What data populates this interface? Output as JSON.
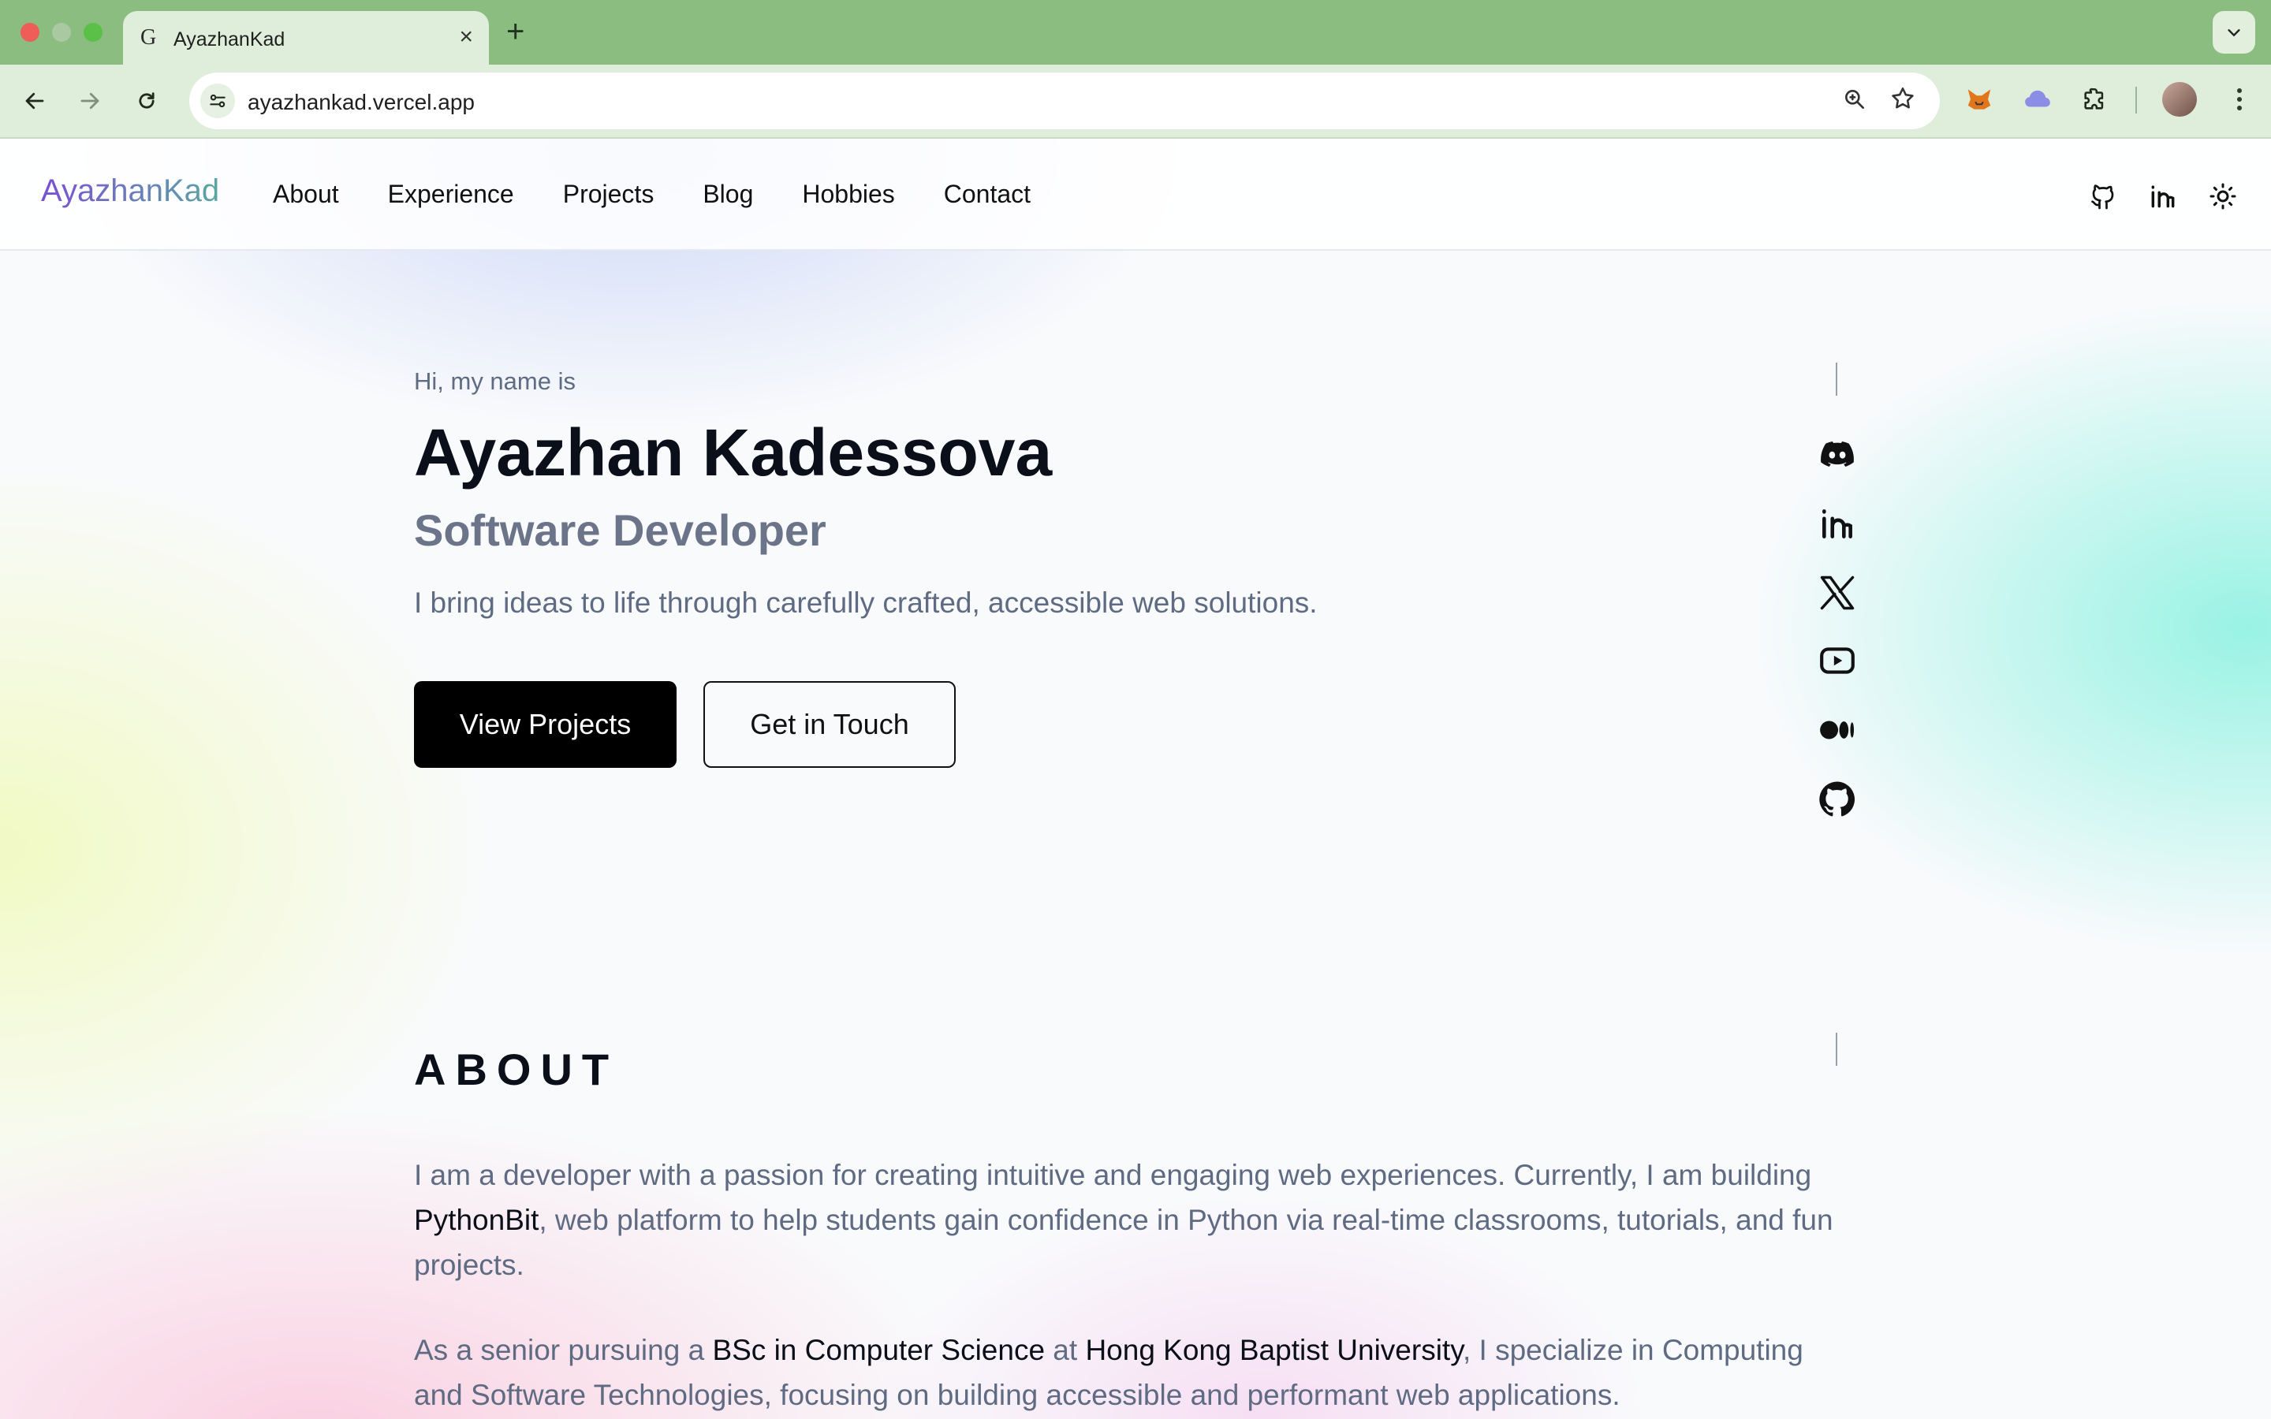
{
  "browser": {
    "tab_title": "AyazhanKad",
    "tab_favicon": "G",
    "url": "ayazhankad.vercel.app"
  },
  "site": {
    "brand": "AyazhanKad",
    "nav": [
      "About",
      "Experience",
      "Projects",
      "Blog",
      "Hobbies",
      "Contact"
    ],
    "nav_icons": [
      "github-icon",
      "linkedin-icon",
      "sun-icon"
    ]
  },
  "hero": {
    "greeting": "Hi, my name is",
    "name": "Ayazhan Kadessova",
    "role": "Software Developer",
    "tagline": "I bring ideas to life through carefully crafted, accessible web solutions.",
    "primary_button": "View Projects",
    "secondary_button": "Get in Touch"
  },
  "social_rail": [
    "discord-icon",
    "linkedin-icon",
    "x-icon",
    "youtube-icon",
    "medium-icon",
    "github-icon"
  ],
  "about": {
    "heading": "ABOUT",
    "p1_a": "I am a developer with a passion for creating intuitive and engaging web experiences. Currently, I am building ",
    "p1_link": "PythonBit",
    "p1_b": ", web platform to help students gain confidence in Python via real-time classrooms, tutorials, and fun projects.",
    "p2_a": "As a senior pursuing a ",
    "p2_degree": "BSc in Computer Science",
    "p2_at": " at ",
    "p2_uni": "Hong Kong Baptist University",
    "p2_b": ", I specialize in Computing and Software Technologies, focusing on building accessible and performant web applications."
  },
  "colors": {
    "chrome_green": "#8bbd80",
    "brand_gradient_start": "#7b4fd6",
    "brand_gradient_end": "#5aa7a0",
    "muted_text": "#5f6b82"
  }
}
